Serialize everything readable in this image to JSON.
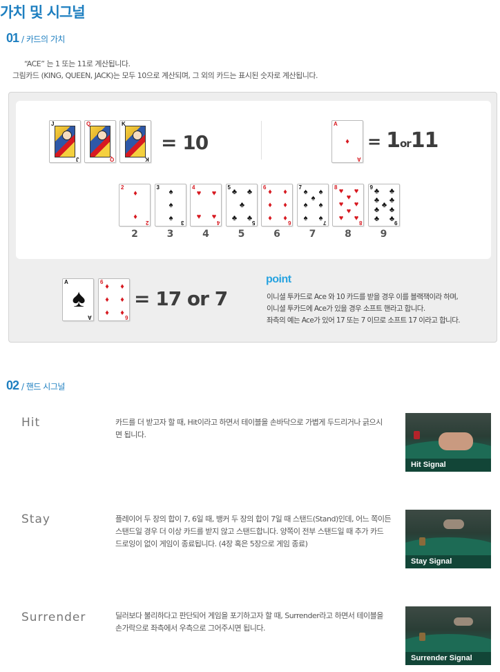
{
  "page_title": "가치 및 시그널",
  "section1": {
    "num": "01",
    "sub": "/ 카드의 가치"
  },
  "intro": {
    "line1": "“ACE” 는 1 또는 11로 계산됩니다.",
    "line2": "그림카드 (KING, QUEEN, JACK)는 모두 10으로 계산되며, 그 외의 카드는 표시된 숫자로 계산됩니다."
  },
  "face_cards": [
    {
      "rank": "J",
      "suit": "♣",
      "color": "black"
    },
    {
      "rank": "Q",
      "suit": "♥",
      "color": "red"
    },
    {
      "rank": "K",
      "suit": "♠",
      "color": "black"
    }
  ],
  "face_value": "= 10",
  "ace_card": {
    "rank": "A",
    "suit": "♦",
    "color": "red"
  },
  "ace_value": {
    "eq": "=",
    "one": "1",
    "or": "or",
    "eleven": "11"
  },
  "number_cards": [
    {
      "rank": "2",
      "suit": "♦",
      "color": "red",
      "label": "2"
    },
    {
      "rank": "3",
      "suit": "♠",
      "color": "black",
      "label": "3"
    },
    {
      "rank": "4",
      "suit": "♥",
      "color": "red",
      "label": "4"
    },
    {
      "rank": "5",
      "suit": "♣",
      "color": "black",
      "label": "5"
    },
    {
      "rank": "6",
      "suit": "♦",
      "color": "red",
      "label": "6"
    },
    {
      "rank": "7",
      "suit": "♠",
      "color": "black",
      "label": "7"
    },
    {
      "rank": "8",
      "suit": "♥",
      "color": "red",
      "label": "8"
    },
    {
      "rank": "9",
      "suit": "♣",
      "color": "black",
      "label": "9"
    }
  ],
  "soft_hand": {
    "ace": {
      "rank": "A",
      "suit": "♠"
    },
    "six": {
      "rank": "6",
      "suit": "♦"
    },
    "value": "= 17 or 7"
  },
  "point": {
    "title": "point",
    "lines": [
      "이니셜 투카드로 Ace 와 10 카드를 받을 경우 이를  블랙잭이라 하며,",
      "이니셜 투카드에 Ace가 있을 경우 소프트 핸라고 합니다.",
      "좌측의 예는 Ace가 있어 17 또는 7 이므로 소프트 17 이라고 합니다."
    ]
  },
  "section2": {
    "num": "02",
    "sub": "/ 핸드 시그널"
  },
  "signals": [
    {
      "name": "Hit",
      "desc": "카드를 더 받고자 할 때, Hit이라고 하면서 테이블을 손바닥으로 가볍게 두드리거나 긁으시면 됩니다.",
      "caption": "Hit Signal"
    },
    {
      "name": "Stay",
      "desc": "플레이어 두 장의 합이 7, 6일 때, 뱅커 두 장의 합이 7일 때 스탠드(Stand)인데, 어느 쪽이든 스탠드일 경우 더 이상 카드를 받지 않고 스탠드합니다. 양쪽이 전부 스탠드일 때 추가 카드 드로잉이 없이 게임이 종료됩니다. (4장 혹은 5장으로 게임 종료)",
      "caption": "Stay Signal"
    },
    {
      "name": "Surrender",
      "desc": "딜러보다 불리하다고 판단되어 게임을 포기하고자 할 때, Surrender라고 하면서 테이블을 손가락으로 좌측에서 우측으로 그어주시면 됩니다.",
      "caption": "Surrender Signal"
    }
  ],
  "colors": {
    "accent": "#1e7fc0",
    "point": "#27a3e0",
    "red_suit": "#d71920"
  }
}
